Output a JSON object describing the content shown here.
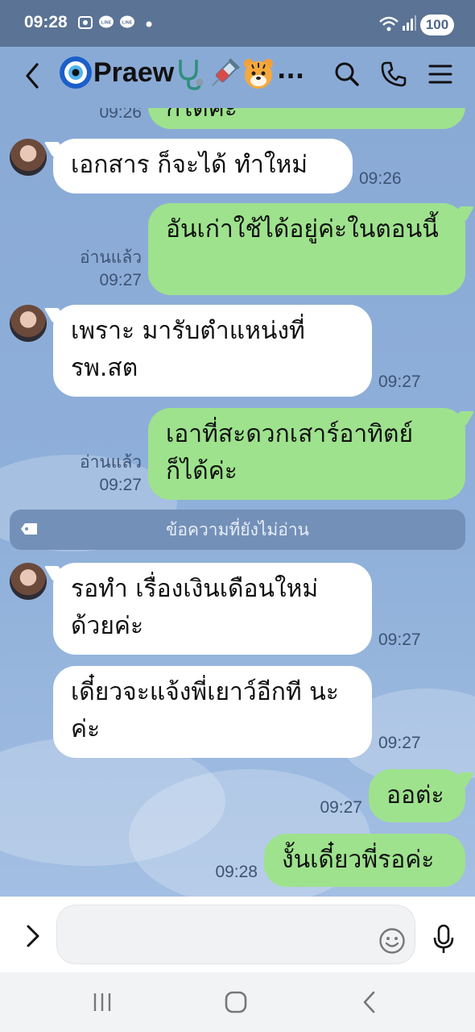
{
  "status_bar": {
    "time": "09:28",
    "battery": "100",
    "icons": [
      "screenshot-icon",
      "line-notification-icon",
      "line-notification-icon",
      "dot-icon",
      "wifi-icon",
      "signal-icon"
    ]
  },
  "header": {
    "contact_name": "Praew",
    "name_emojis": [
      "🩺",
      "💉",
      "🐯"
    ],
    "overflow": "...",
    "icons": [
      "back-icon",
      "evil-eye-icon",
      "search-icon",
      "phone-icon",
      "menu-icon"
    ]
  },
  "messages": [
    {
      "side": "out",
      "text": "ก็ได้ค่ะ",
      "time": "09:26",
      "status": "",
      "clipped": true
    },
    {
      "side": "in",
      "text": "เอกสาร ก็จะได้ ทำใหม่",
      "time": "09:26"
    },
    {
      "side": "out",
      "text": "อันเก่าใช้ได้อยู่ค่ะในตอนนี้",
      "read": "อ่านแล้ว",
      "time": "09:27"
    },
    {
      "side": "in",
      "text": "เพราะ มารับตำแหน่งที่ รพ.สต",
      "time": "09:27"
    },
    {
      "side": "out",
      "text": "เอาที่สะดวกเสาร์อาทิตย์ ก็ได้ค่ะ",
      "read": "อ่านแล้ว",
      "time": "09:27"
    },
    {
      "side": "in",
      "text": "รอทำ เรื่องเงินเดือนใหม่ ด้วยค่ะ",
      "time": "09:27"
    },
    {
      "side": "in",
      "text": "เดี๋ยวจะแจ้งพี่เยาว์อีกที นะค่ะ",
      "time": "09:27"
    },
    {
      "side": "out",
      "text": "ออต่ะ",
      "time": "09:27"
    },
    {
      "side": "out",
      "text": "งั้นเดี๋ยวพี่รอค่ะ",
      "time": "09:28"
    }
  ],
  "unread_divider": "ข้อความที่ยังไม่อ่าน",
  "input": {
    "placeholder": ""
  },
  "colors": {
    "background": "#8aaad6",
    "status_bar": "#5b7394",
    "incoming_bubble": "#ffffff",
    "outgoing_bubble": "#9ee28d",
    "divider": "#7390b8"
  }
}
